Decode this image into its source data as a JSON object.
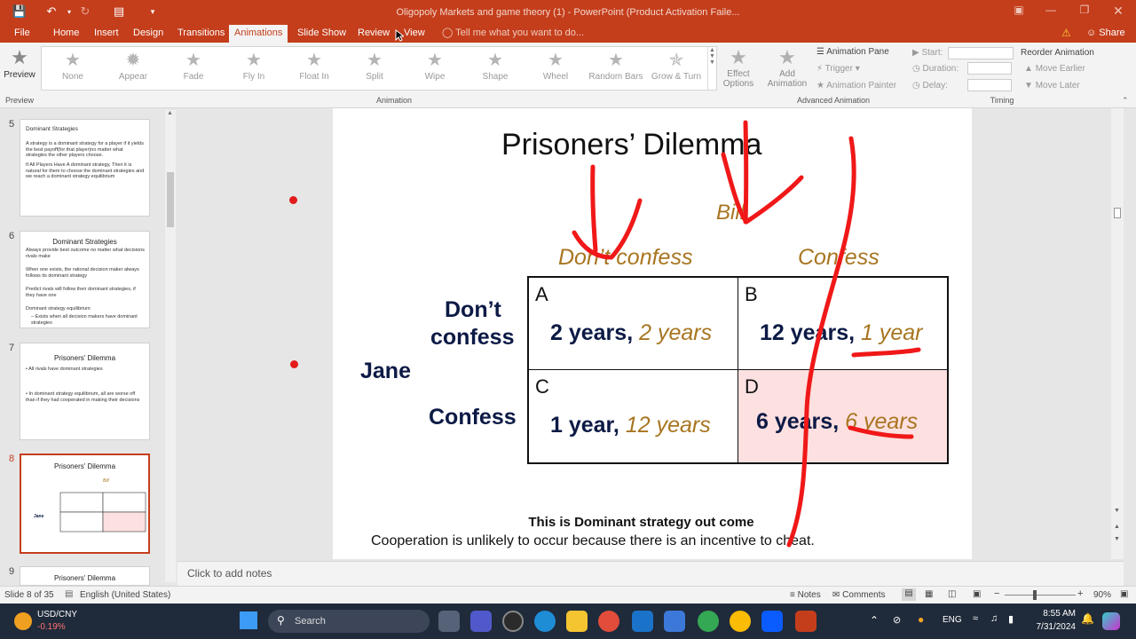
{
  "window": {
    "title": "Oligopoly Markets and game theory (1) - PowerPoint (Product Activation Faile...",
    "share_label": "Share"
  },
  "ribbon_tabs": [
    "File",
    "Home",
    "Insert",
    "Design",
    "Transitions",
    "Animations",
    "Slide Show",
    "Review",
    "View"
  ],
  "active_tab": "Animations",
  "tell_me": "Tell me what you want to do...",
  "preview": {
    "label": "Preview",
    "group": "Preview"
  },
  "animations": [
    "None",
    "Appear",
    "Fade",
    "Fly In",
    "Float In",
    "Split",
    "Wipe",
    "Shape",
    "Wheel",
    "Random Bars",
    "Grow & Turn"
  ],
  "animation_group": "Animation",
  "effect_options": {
    "line1": "Effect",
    "line2": "Options"
  },
  "add_animation": {
    "line1": "Add",
    "line2": "Animation"
  },
  "advanced": {
    "pane": "Animation Pane",
    "trigger": "Trigger",
    "painter": "Animation Painter",
    "group": "Advanced Animation"
  },
  "timing": {
    "start": "Start:",
    "duration": "Duration:",
    "delay": "Delay:",
    "reorder": "Reorder Animation",
    "move_earlier": "Move Earlier",
    "move_later": "Move Later",
    "group": "Timing"
  },
  "thumbnails": [
    {
      "num": "5",
      "title": "Dominant Strategies",
      "lines": [
        "A strategy is a dominant strategy for a player if it yields the best payoff(for that player)no matter what strategies the other players choose.",
        "If All Players Have A dominant strategy, Then it is natural for them to choose the dominant strategies and we reach a dominant strategy equilibrium"
      ]
    },
    {
      "num": "6",
      "title": "Dominant Strategies",
      "lines": [
        "Always provide best outcome no matter what decisions rivals make",
        "When one exists, the rational decision maker always follows its dominant strategy",
        "Predict rivals will follow their dominant strategies, if they have one",
        "Dominant strategy equilibrium",
        "– Exists when all decision makers have dominant strategies"
      ]
    },
    {
      "num": "7",
      "title": "Prisoners' Dilemma",
      "lines": [
        "• All rivals have dominant strategies",
        "• In dominant strategy equilibrium, all are worse off than if they had cooperated in making their decisions"
      ]
    },
    {
      "num": "8",
      "title": "Prisoners' Dilemma",
      "lines": []
    },
    {
      "num": "9",
      "title": "Prisoners' Dilemma",
      "lines": []
    }
  ],
  "slide": {
    "title": "Prisoners’ Dilemma",
    "bill": "Bill",
    "col_headers": [
      "Don’t confess",
      "Confess"
    ],
    "row_label_1a": "Don’t",
    "row_label_1b": "confess",
    "row_label_2": "Confess",
    "jane": "Jane",
    "cells": [
      {
        "letter": "A",
        "jane": "2 years,",
        "bill": "2 years"
      },
      {
        "letter": "B",
        "jane": "12 years,",
        "bill": "1 year"
      },
      {
        "letter": "C",
        "jane": "1 year,",
        "bill": "12 years"
      },
      {
        "letter": "D",
        "jane": "6 years,",
        "bill": "6 years"
      }
    ],
    "bottom_bold": "This is Dominant strategy out come",
    "bottom_text": "Cooperation is unlikely to occur because there is an incentive to cheat."
  },
  "notes_placeholder": "Click to add notes",
  "status": {
    "slide_of": "Slide 8 of 35",
    "language": "English (United States)",
    "notes": "Notes",
    "comments": "Comments",
    "zoom": "90%"
  },
  "taskbar": {
    "ticker": "USD/CNY",
    "change": "-0.19%",
    "search": "Search",
    "lang": "ENG",
    "time": "8:55 AM",
    "date": "7/31/2024"
  },
  "colors": {
    "accent": "#c43e1c",
    "bill_text": "#a87520",
    "jane_text": "#0c1a45",
    "ink_red": "#f01818",
    "highlight_cell": "#fde0e0"
  }
}
